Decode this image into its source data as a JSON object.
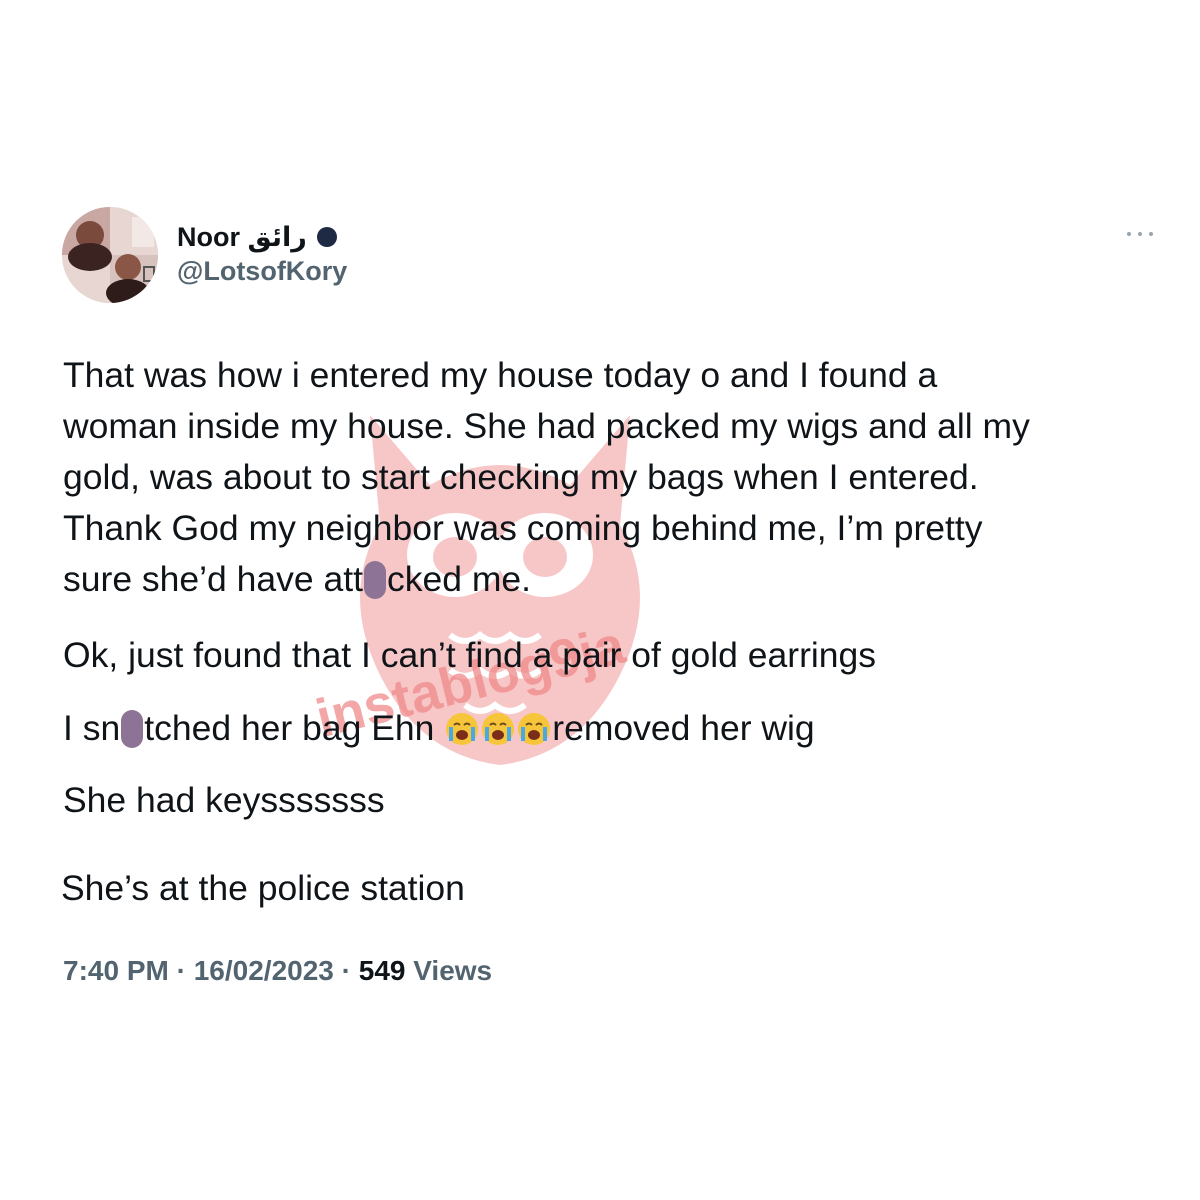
{
  "user": {
    "display_name": "Noor رائق",
    "handle": "@LotsofKory"
  },
  "icons": {
    "avatar": "profile-photo",
    "badge": "dark-blue-dot",
    "more": "more-options-icon",
    "emoji": "loudly-crying-face"
  },
  "tweet": {
    "line1": "That was how i entered my house today o and I found a",
    "line2": "woman inside my house. She had packed my wigs and all my",
    "line3": "gold, was about to start checking my bags when I entered.",
    "line4": "Thank God my neighbor was coming behind me, I’m pretty",
    "line5a": "sure she’d have att",
    "line5b": "cked me.",
    "para2": "Ok, just found that I can’t find a pair of gold earrings",
    "para3a": "I sn",
    "para3b": "tched her bag Ehn",
    "para3c": "removed her wig",
    "para4": "She had keysssssss",
    "para5": "She’s at the police station"
  },
  "meta": {
    "time": "7:40 PM",
    "separator": " · ",
    "date": "16/02/2023",
    "views_count": "549",
    "views_label": "Views"
  },
  "watermark": {
    "text": "instablog9ja"
  },
  "colors": {
    "text": "#0f1419",
    "secondary": "#536471",
    "censor": "#8d7396",
    "watermark": "#f08a8a"
  }
}
